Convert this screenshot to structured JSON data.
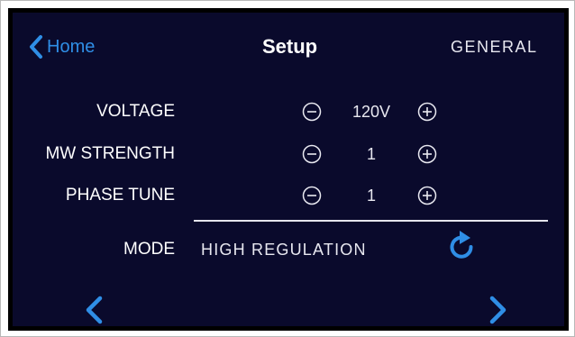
{
  "header": {
    "back_label": "Home",
    "title": "Setup",
    "section": "GENERAL"
  },
  "settings": [
    {
      "label": "VOLTAGE",
      "value": "120V"
    },
    {
      "label": "MW STRENGTH",
      "value": "1"
    },
    {
      "label": "PHASE TUNE",
      "value": "1"
    }
  ],
  "mode": {
    "label": "MODE",
    "value": "HIGH REGULATION"
  },
  "icons": {
    "back": "chevron-left-icon",
    "decrement": "minus-circle-icon",
    "increment": "plus-circle-icon",
    "refresh": "refresh-icon",
    "prev": "chevron-left-icon",
    "next": "chevron-right-icon"
  },
  "colors": {
    "background": "#0a0a2c",
    "accent": "#2f8ee6",
    "text": "#ffffff"
  }
}
